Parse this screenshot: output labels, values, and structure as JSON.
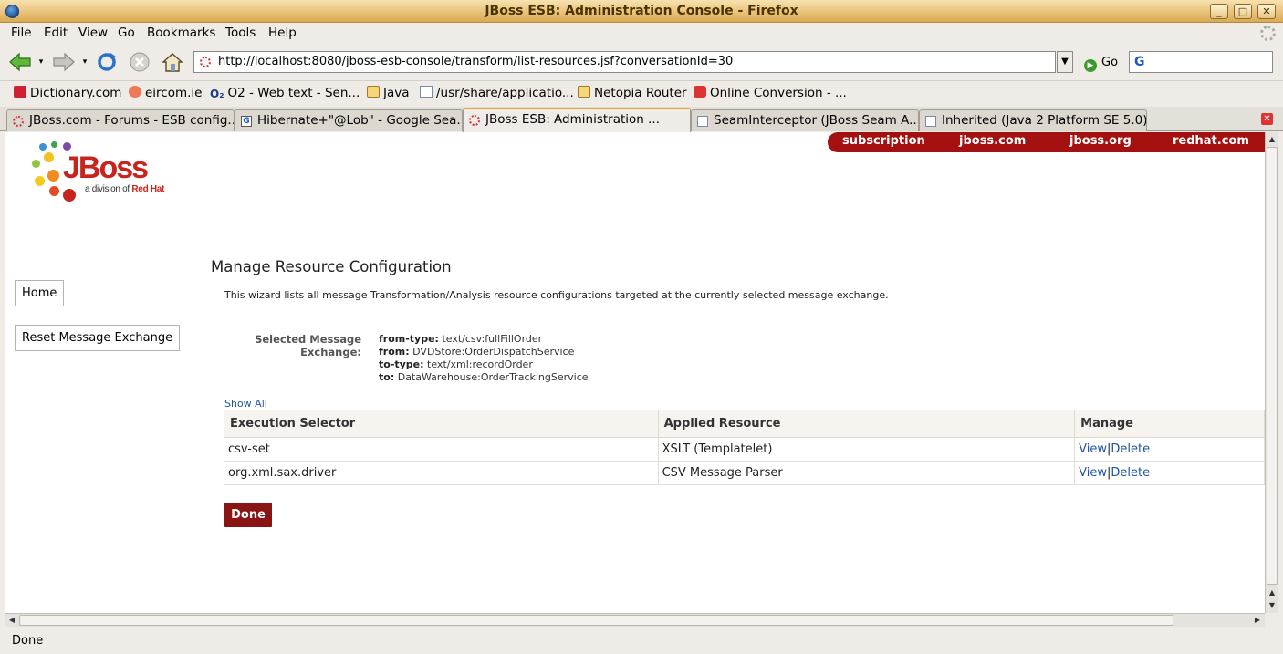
{
  "window": {
    "title": "JBoss ESB: Administration Console - Firefox",
    "buttons": {
      "minimize": "_",
      "maximize": "□",
      "close": "✕"
    }
  },
  "menu": [
    "File",
    "Edit",
    "View",
    "Go",
    "Bookmarks",
    "Tools",
    "Help"
  ],
  "nav": {
    "url": "http://localhost:8080/jboss-esb-console/transform/list-resources.jsf?conversationId=30",
    "go_label": "Go",
    "search_value": ""
  },
  "bookmarks": [
    {
      "label": "Dictionary.com",
      "icon": "dictionary-icon"
    },
    {
      "label": "eircom.ie",
      "icon": "eircom-icon"
    },
    {
      "label": "O2 - Web text - Sen...",
      "icon": "o2-icon"
    },
    {
      "label": "Java",
      "icon": "folder-icon"
    },
    {
      "label": "/usr/share/applicatio...",
      "icon": "document-icon"
    },
    {
      "label": "Netopia Router",
      "icon": "folder-icon"
    },
    {
      "label": "Online Conversion - ...",
      "icon": "conversion-icon"
    }
  ],
  "tabs": [
    {
      "label": "JBoss.com - Forums - ESB config...",
      "icon": "loading-icon",
      "active": false
    },
    {
      "label": "Hibernate+\"@Lob\" - Google Sea...",
      "icon": "google-icon",
      "active": false
    },
    {
      "label": "JBoss ESB: Administration ...",
      "icon": "loading-icon",
      "active": true
    },
    {
      "label": "SeamInterceptor (JBoss Seam A...",
      "icon": "document-icon",
      "active": false
    },
    {
      "label": "Inherited (Java 2 Platform SE 5.0)",
      "icon": "document-icon",
      "active": false
    }
  ],
  "page": {
    "topnav": [
      "subscription",
      "jboss.com",
      "jboss.org",
      "redhat.com"
    ],
    "logo": {
      "brand": "JBoss",
      "tagline_prefix": "a division of ",
      "tagline_brand": "Red Hat"
    },
    "sidebar": {
      "home": "Home",
      "reset": "Reset Message Exchange"
    },
    "heading": "Manage Resource Configuration",
    "description": "This wizard lists all message Transformation/Analysis resource configurations targeted at the currently selected message exchange.",
    "exchange": {
      "label": "Selected Message Exchange:",
      "from_type_label": "from-type:",
      "from_type": "text/csv:fullFillOrder",
      "from_label": "from:",
      "from": "DVDStore:OrderDispatchService",
      "to_type_label": "to-type:",
      "to_type": "text/xml:recordOrder",
      "to_label": "to:",
      "to": "DataWarehouse:OrderTrackingService"
    },
    "show_all": "Show All",
    "table": {
      "headers": [
        "Execution Selector",
        "Applied Resource",
        "Manage"
      ],
      "rows": [
        {
          "selector": "csv-set",
          "resource": "XSLT (Templatelet)",
          "view": "View",
          "sep": "|",
          "delete": "Delete"
        },
        {
          "selector": "org.xml.sax.driver",
          "resource": "CSV Message Parser",
          "view": "View",
          "sep": "|",
          "delete": "Delete"
        }
      ]
    },
    "done": "Done"
  },
  "status": "Done",
  "colors": {
    "brand_red": "#a40f0f",
    "link_blue": "#1f55a3",
    "tab_accent": "#e8a33d"
  }
}
